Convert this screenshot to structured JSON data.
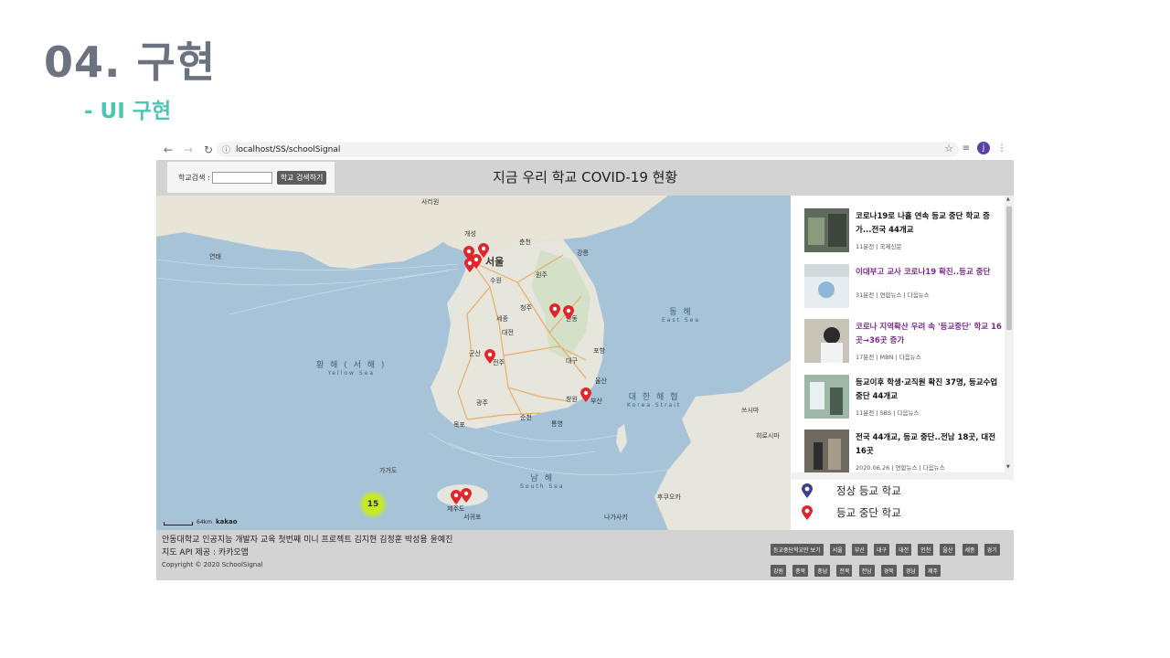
{
  "slide": {
    "title": "04. 구현",
    "subtitle": "- UI 구현"
  },
  "browser": {
    "url": "localhost/SS/schoolSignal",
    "avatar_letter": "j",
    "reading_list_icon": "≡"
  },
  "header": {
    "search_label": "학교검색 :",
    "search_value": "",
    "search_button": "학교 검색하기",
    "page_title": "지금 우리 학교 COVID-19 현황"
  },
  "map": {
    "cluster_count": "15",
    "scale_text": "64km",
    "provider": "kakao",
    "labels": {
      "sariwon": "사리원",
      "gaeseong": "개성",
      "seoul": "서울",
      "suwon": "수원",
      "incheon": "인천",
      "chuncheon": "춘천",
      "gangneung": "강릉",
      "wonju": "원주",
      "cheongju": "청주",
      "sejong": "세종",
      "daejeon": "대전",
      "jeonju": "전주",
      "gunsan": "군산",
      "gwangju": "광주",
      "mokpo": "목포",
      "suncheon": "순천",
      "daegu": "대구",
      "busan": "부산",
      "ulsan": "울산",
      "pohang": "포항",
      "andong": "안동",
      "changwon": "창원",
      "tongyeong": "통영",
      "jeju": "제주도",
      "seogwipo": "서귀포",
      "ulleung": "울릉도",
      "tsushima": "쓰시마",
      "hirosima": "히로시마",
      "fukuoka": "후쿠오카",
      "nagasaki": "나가사키",
      "gagado": "가거도",
      "dokdo": "독도",
      "yanyang": "영양",
      "chungju": "충주",
      "cheonan": "천안",
      "pyeongtaek": "평택",
      "hongseong": "홍성",
      "seosan": "서산",
      "jincheon": "진천",
      "sokcho": "속초",
      "samcheok": "삼척",
      "taebaek": "태백",
      "geoje": "거제",
      "yeosu": "여수",
      "gumi": "구미",
      "gimcheon": "김천",
      "namwon": "남원",
      "jeongeup": "정읍",
      "imsil": "임실",
      "boryeong": "보령",
      "gongju": "공주",
      "nonsan": "논산",
      "yeongju": "영주"
    },
    "seas": {
      "yellow_kr": "황 해 ( 서 해 )",
      "yellow_en": "Yellow Sea",
      "east_kr": "동 해",
      "east_en": "East Sea",
      "south_kr": "남 해",
      "south_en": "South Sea",
      "strait_kr": "대 한 해 협",
      "strait_en": "Korea Strait",
      "pyeonghwa": "연태"
    }
  },
  "news": [
    {
      "title": "코로나19로 나흘 연속 등교 중단 학교 증가...전국 44개교",
      "meta": "11분전 | 국제신문",
      "visited": false
    },
    {
      "title": "이대부고 교사 코로나19 확진..등교 중단",
      "meta": "31분전 | 연합뉴스 | 다음뉴스",
      "visited": true
    },
    {
      "title": "코로나 지역확산 우려 속 '등교중단' 학교 16곳→36곳 증가",
      "meta": "17분전 | MBN | 다음뉴스",
      "visited": true
    },
    {
      "title": "등교이후 학생·교직원 확진 37명, 등교수업 중단 44개교",
      "meta": "11분전 | SBS | 다음뉴스",
      "visited": false
    },
    {
      "title": "전국 44개교, 등교 중단..전남 18곳, 대전 16곳",
      "meta": "2020.06.26 | 연합뉴스 | 다음뉴스",
      "visited": false
    }
  ],
  "legend": {
    "normal": "정상 등교 학교",
    "stopped": "등교 중단 학교",
    "normal_color": "#3b3f8f",
    "stopped_color": "#e0252b"
  },
  "footer": {
    "credit_line1": "안동대학교 인공지능 개발자 교육 첫번째 미니 프로젝트 김지현 김정훈 박성용 윤예진",
    "credit_line2": "지도 API 제공 : 카카오맵",
    "copyright": "Copyright © 2020 SchoolSignal",
    "regions": [
      "등교중단학교만 보기",
      "서울",
      "부산",
      "대구",
      "대전",
      "인천",
      "울산",
      "세종",
      "경기",
      "강원",
      "충북",
      "충남",
      "전북",
      "전남",
      "경북",
      "경남",
      "제주"
    ]
  }
}
